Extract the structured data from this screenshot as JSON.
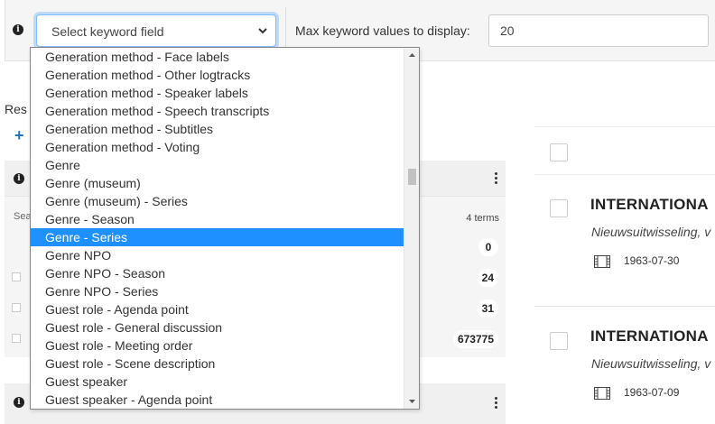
{
  "toolbar": {
    "select_placeholder": "Select keyword field",
    "max_label": "Max keyword values to display:",
    "max_value": "20"
  },
  "dropdown": {
    "items": [
      "Generation method - Face labels",
      "Generation method - Other logtracks",
      "Generation method - Speaker labels",
      "Generation method - Speech transcripts",
      "Generation method - Subtitles",
      "Generation method - Voting",
      "Genre",
      "Genre (museum)",
      "Genre (museum) - Series",
      "Genre - Season",
      "Genre - Series",
      "Genre NPO",
      "Genre NPO - Season",
      "Genre NPO - Series",
      "Guest role - Agenda point",
      "Guest role - General discussion",
      "Guest role - Meeting order",
      "Guest role - Scene description",
      "Guest speaker",
      "Guest speaker - Agenda point"
    ],
    "selected_index": 10
  },
  "left_panel": {
    "results_label": "Res",
    "plus_icon": "+",
    "search_fragment": "Sea",
    "terms_count": "4 terms",
    "counts": [
      "0",
      "24",
      "31",
      "673775"
    ]
  },
  "results": [
    {
      "title": "INTERNATIONA",
      "subtitle": "Nieuwsuitwisseling, v",
      "date": "1963-07-30"
    },
    {
      "title": "INTERNATIONA",
      "subtitle": "Nieuwsuitwisseling, v",
      "date": "1963-07-09"
    }
  ],
  "colors": {
    "selected_bg": "#1e90ff",
    "focus_border": "#80bdff",
    "plus_blue": "#1e73be"
  }
}
